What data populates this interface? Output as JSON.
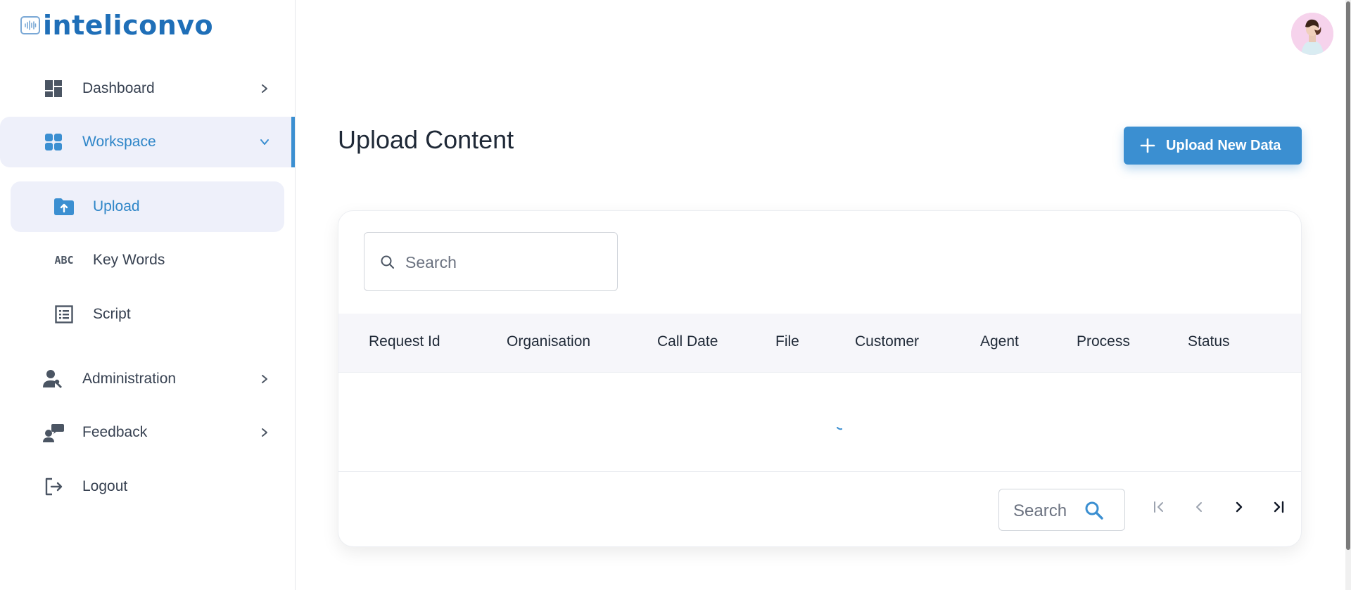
{
  "brand": {
    "name": "inteliconvo"
  },
  "sidebar": {
    "items": [
      {
        "label": "Dashboard",
        "icon": "dashboard-icon"
      },
      {
        "label": "Workspace",
        "icon": "grid-icon"
      },
      {
        "label": "Administration",
        "icon": "admin-icon"
      },
      {
        "label": "Feedback",
        "icon": "feedback-icon"
      },
      {
        "label": "Logout",
        "icon": "logout-icon"
      }
    ],
    "workspace_sub": [
      {
        "label": "Upload",
        "icon": "folder-upload-icon"
      },
      {
        "label": "Key Words",
        "icon": "abc-icon"
      },
      {
        "label": "Script",
        "icon": "list-icon"
      }
    ],
    "abc_glyph": "ABC"
  },
  "main": {
    "title": "Upload Content",
    "upload_button": "Upload New Data",
    "search_placeholder": "Search",
    "columns": [
      "Request Id",
      "Organisation",
      "Call Date",
      "File",
      "Customer",
      "Agent",
      "Process",
      "Status"
    ],
    "footer_search": "Search"
  },
  "colors": {
    "accent": "#3b8fd1",
    "brand": "#1f6fb8",
    "active_bg": "#eef0fa"
  }
}
